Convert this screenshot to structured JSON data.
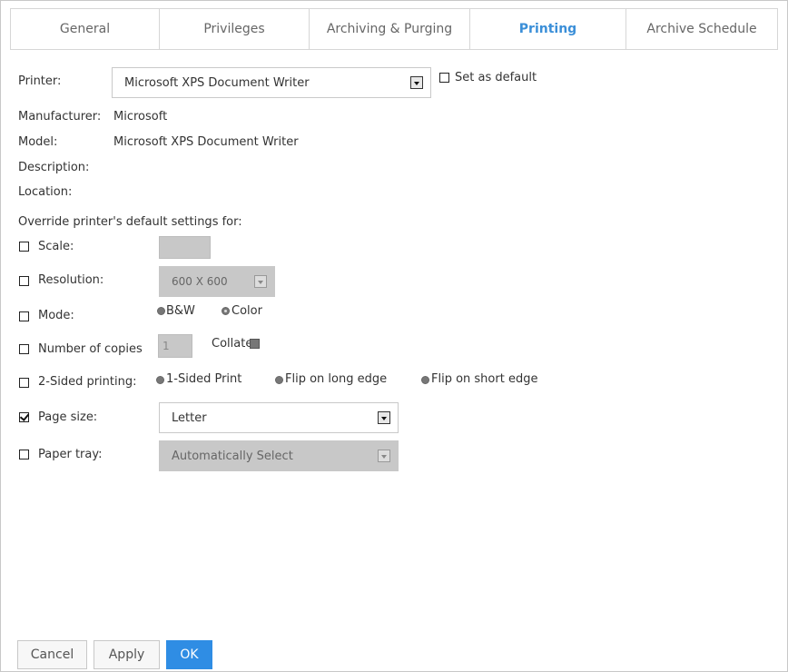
{
  "tabs": [
    {
      "label": "General"
    },
    {
      "label": "Privileges"
    },
    {
      "label": "Archiving & Purging"
    },
    {
      "label": "Printing",
      "active": true
    },
    {
      "label": "Archive Schedule"
    }
  ],
  "printer": {
    "label": "Printer:",
    "value": "Microsoft XPS Document Writer",
    "set_default_label": "Set as default",
    "set_default_checked": false
  },
  "info": {
    "manufacturer_label": "Manufacturer:",
    "manufacturer_value": "Microsoft",
    "model_label": "Model:",
    "model_value": "Microsoft XPS Document Writer",
    "description_label": "Description:",
    "location_label": "Location:"
  },
  "override": {
    "heading": "Override printer's default settings for:",
    "scale": {
      "label": "Scale:",
      "checked": false,
      "value": ""
    },
    "resolution": {
      "label": "Resolution:",
      "checked": false,
      "value": "600 X 600"
    },
    "mode": {
      "label": "Mode:",
      "checked": false,
      "options": [
        "B&W",
        "Color"
      ],
      "selected": "Color"
    },
    "copies": {
      "label": "Number of copies",
      "checked": false,
      "value": "1",
      "collate_label": "Collate"
    },
    "sided": {
      "label": "2-Sided printing:",
      "checked": false,
      "options": [
        "1-Sided Print",
        "Flip on long edge",
        "Flip on short edge"
      ]
    },
    "page_size": {
      "label": "Page size:",
      "checked": true,
      "value": "Letter"
    },
    "paper_tray": {
      "label": "Paper tray:",
      "checked": false,
      "value": "Automatically Select"
    }
  },
  "buttons": {
    "cancel": "Cancel",
    "apply": "Apply",
    "ok": "OK"
  },
  "colors": {
    "accent": "#2f8de4",
    "active_tab": "#3b8fd8",
    "disabled_field": "#c8c8c8"
  }
}
